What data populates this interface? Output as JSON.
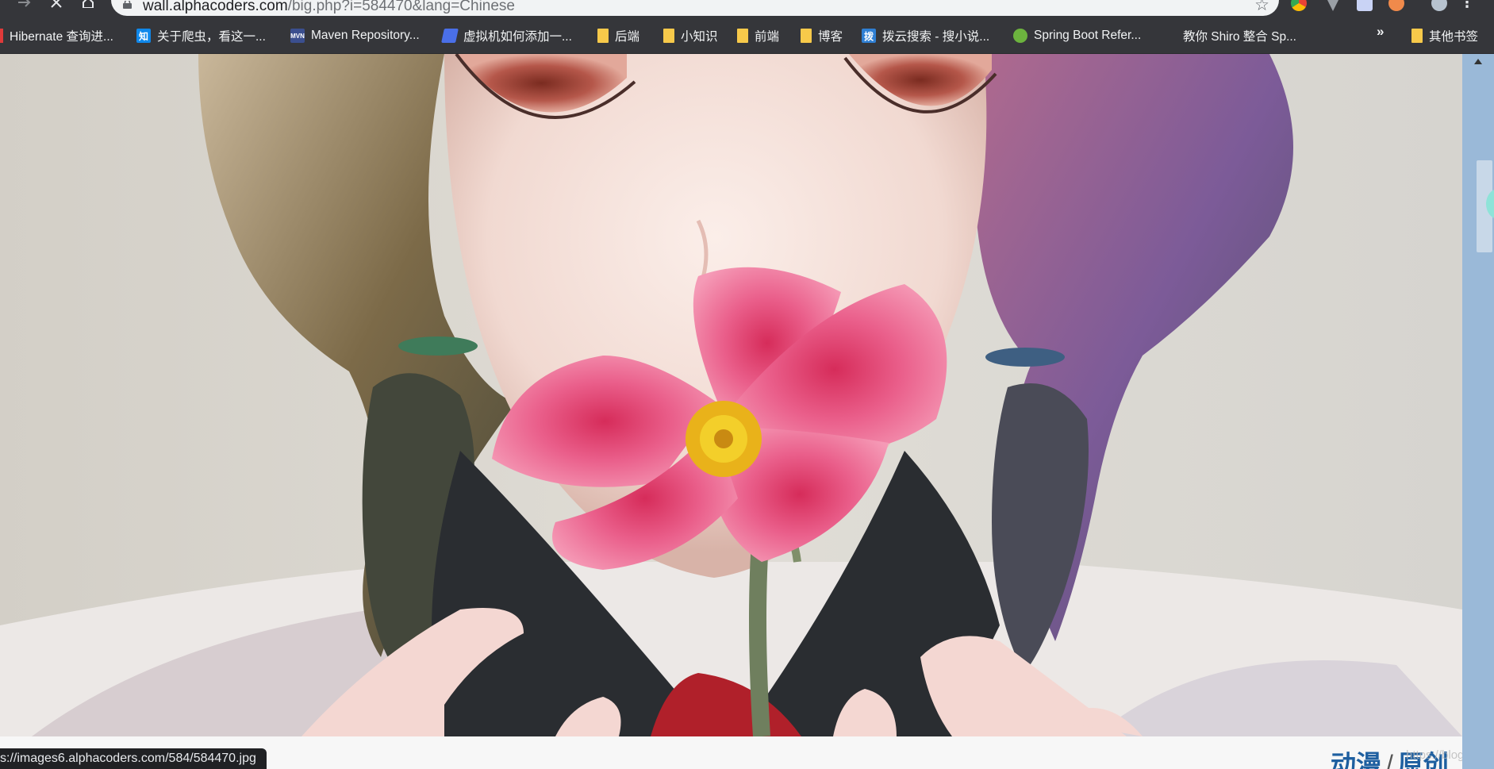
{
  "browser": {
    "url_host": "wall.alphacoders.com",
    "url_path": "/big.php?i=584470&lang=Chinese",
    "status_url": "s://images6.alphacoders.com/584/584470.jpg"
  },
  "bookmarks": [
    {
      "label": "Hibernate 查询进...",
      "icon": "hibernate-icon"
    },
    {
      "label": "关于爬虫，看这一...",
      "icon": "zhihu-icon",
      "glyph": "知"
    },
    {
      "label": "Maven Repository...",
      "icon": "maven-icon",
      "glyph": "MVN"
    },
    {
      "label": "虚拟机如何添加一...",
      "icon": "pen-icon"
    },
    {
      "label": "后端",
      "icon": "folder-icon"
    },
    {
      "label": "小知识",
      "icon": "folder-icon"
    },
    {
      "label": "前端",
      "icon": "folder-icon"
    },
    {
      "label": "博客",
      "icon": "folder-icon"
    },
    {
      "label": "拨云搜索 - 搜小说...",
      "icon": "bayun-icon",
      "glyph": "拨"
    },
    {
      "label": "Spring Boot Refer...",
      "icon": "spring-icon"
    },
    {
      "label": "教你 Shiro 整合 Sp...",
      "icon": "blank-page-icon"
    },
    {
      "label": "其他书签",
      "icon": "folder-icon"
    }
  ],
  "bookmarks_more": "»",
  "page": {
    "category": "动漫",
    "separator": "/",
    "subcategory": "原创",
    "watermark": "https://blog.csdn.net/..."
  },
  "colors": {
    "chrome_bar": "#35363a",
    "folder_yellow": "#f7c94a",
    "scrollbar": "#9ab9d8",
    "category_link": "#1e5fa0"
  }
}
